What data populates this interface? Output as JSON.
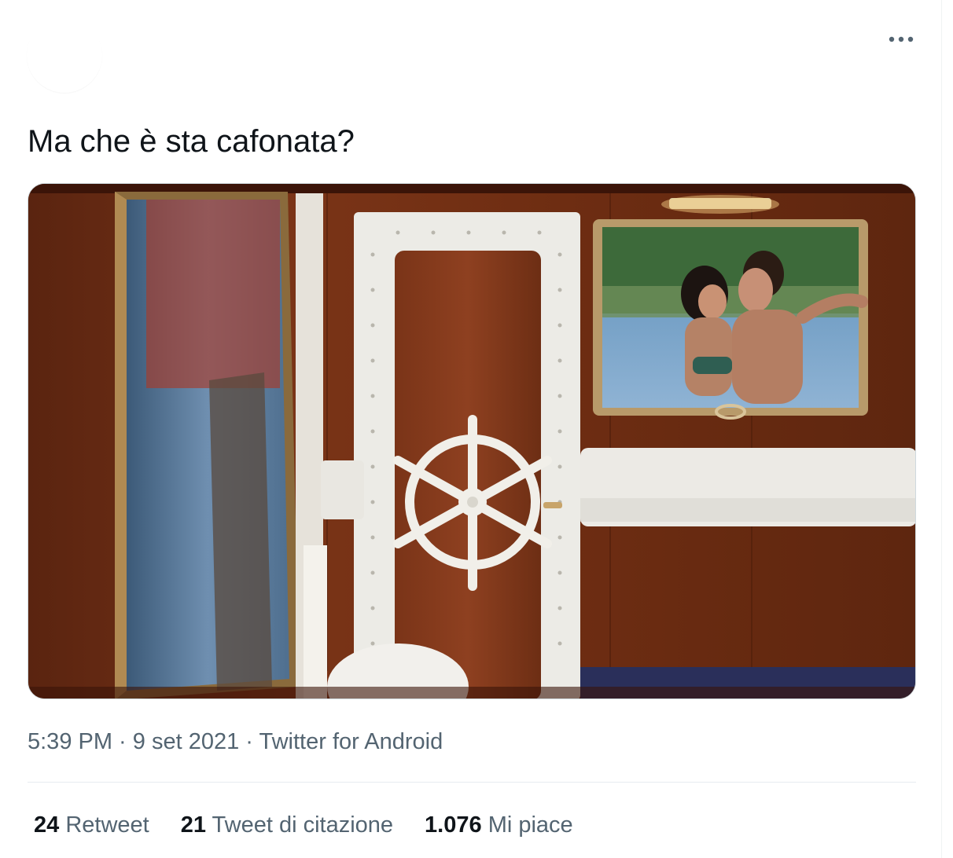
{
  "tweet": {
    "text": "Ma che è sta cafonata?",
    "more_icon": "more-horizontal-icon",
    "media": {
      "kind": "photo",
      "icon": "photo"
    },
    "meta": {
      "time": "5:39 PM",
      "separator1": " · ",
      "date": "9 set 2021",
      "separator2": " · ",
      "source": "Twitter for Android"
    },
    "stats": {
      "retweets": {
        "count": "24",
        "label": "Retweet"
      },
      "quotes": {
        "count": "21",
        "label": "Tweet di citazione"
      },
      "likes": {
        "count": "1.076",
        "label": "Mi piace"
      }
    }
  },
  "colors": {
    "text_primary": "#0f1419",
    "text_secondary": "#536471",
    "divider": "#e6ecf0"
  }
}
